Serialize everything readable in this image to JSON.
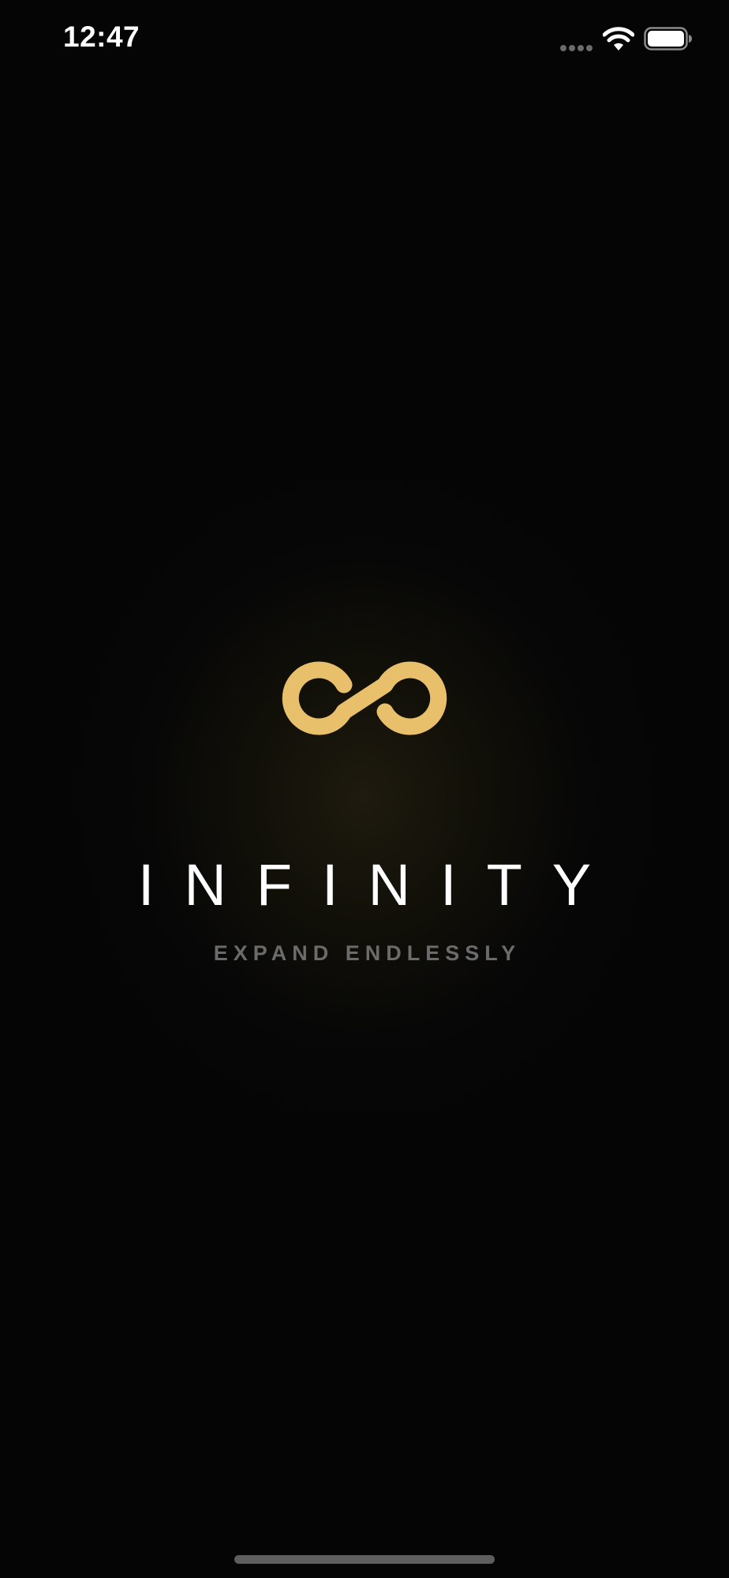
{
  "status_bar": {
    "time": "12:47",
    "signal_icon": "signal-dots-icon",
    "wifi_icon": "wifi-icon",
    "battery_icon": "battery-full-icon"
  },
  "splash": {
    "logo_icon": "infinity-logo-icon",
    "title": "INFINITY",
    "tagline": "EXPAND ENDLESSLY"
  },
  "colors": {
    "background": "#050505",
    "glow": "#1e1a0f",
    "logo_gold": "#E8C06C",
    "title_text": "#FFFFFF",
    "tagline_text": "#6B6B6B"
  }
}
